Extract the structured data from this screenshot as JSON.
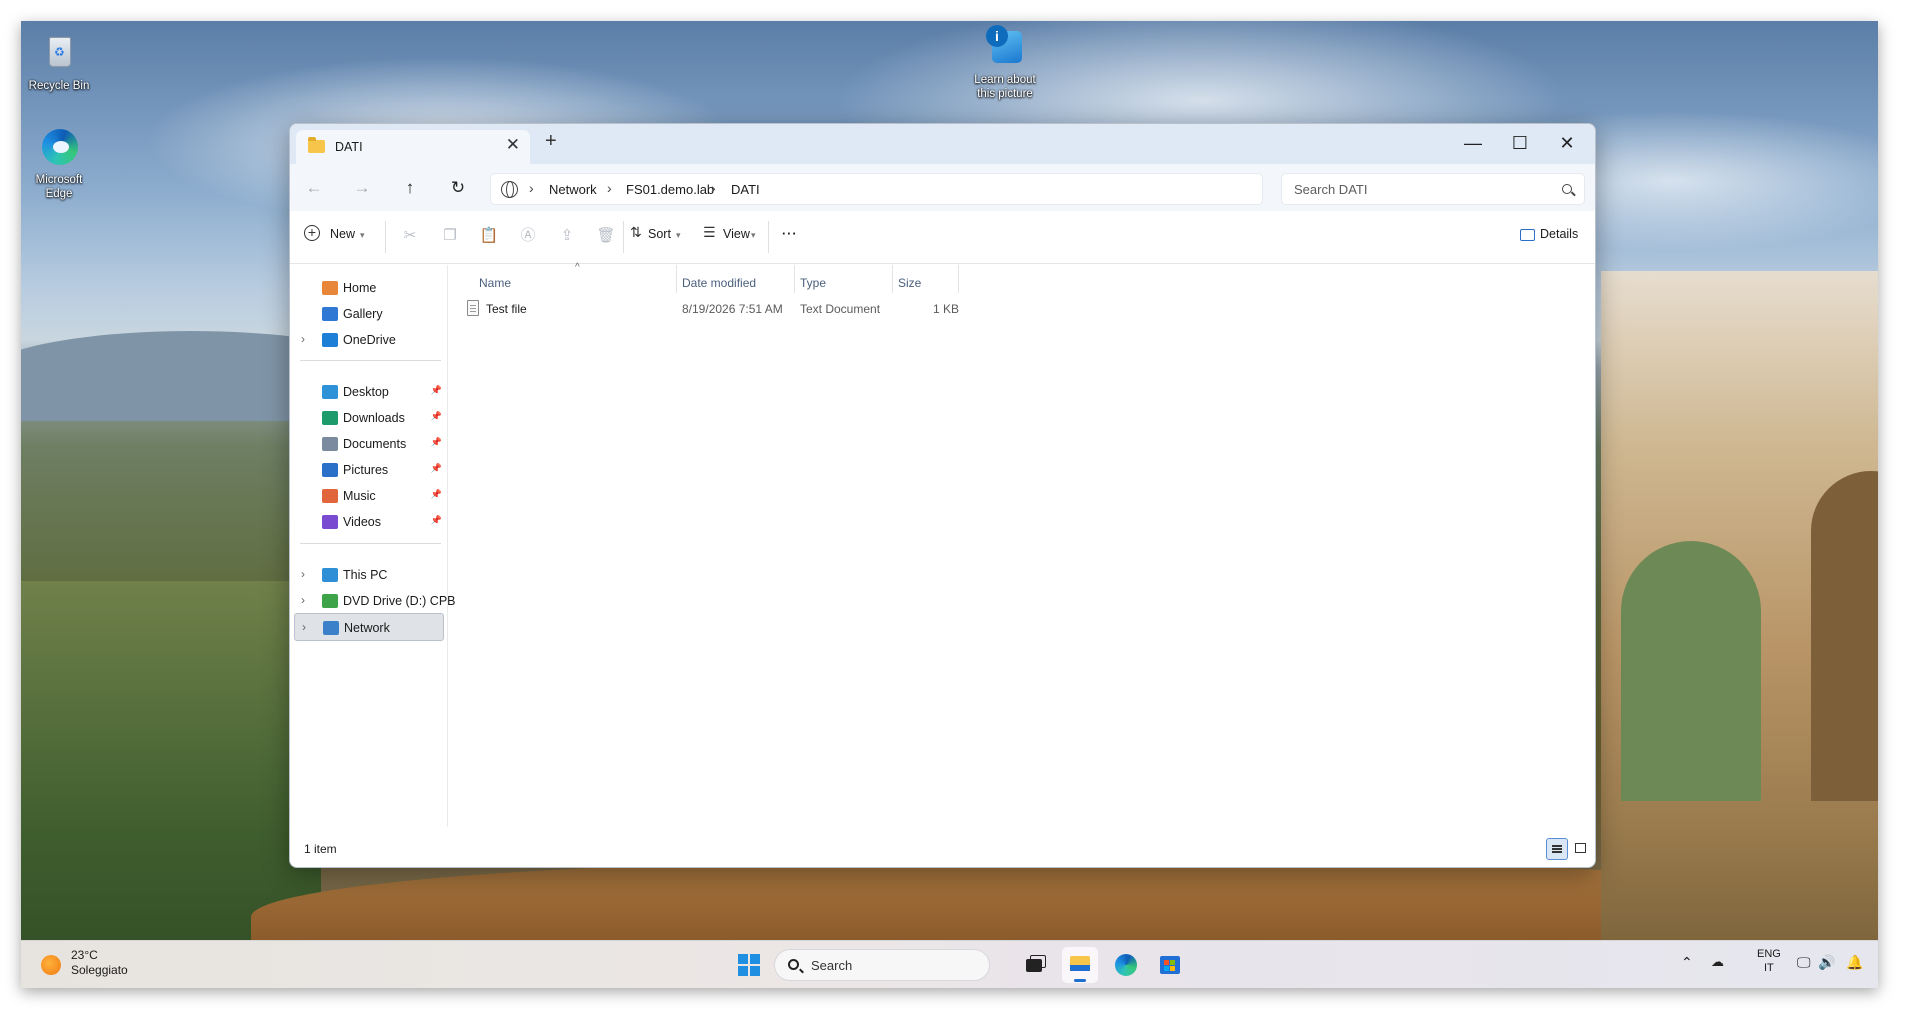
{
  "desktop": {
    "icons": [
      {
        "label": "Recycle Bin"
      },
      {
        "label": "Learn about this picture"
      },
      {
        "label": "Microsoft Edge"
      }
    ]
  },
  "window": {
    "tab_title": "DATI",
    "new_tab_symbol": "+",
    "controls": {
      "minimize": "—",
      "maximize": "☐",
      "close": "✕"
    }
  },
  "navigation": {
    "back_icon": "arrow-left-icon",
    "forward_icon": "arrow-right-icon",
    "up_icon": "arrow-up-icon",
    "refresh_icon": "refresh-icon",
    "breadcrumb": [
      "Network",
      "FS01.demo.lab",
      "DATI"
    ],
    "search_placeholder": "Search DATI"
  },
  "commandbar": {
    "new_label": "New",
    "sort_label": "Sort",
    "view_label": "View",
    "more_label": "···",
    "details_label": "Details"
  },
  "sidebar": {
    "groups": [
      [
        {
          "label": "Home",
          "icon": "home-icon",
          "color": "#e8863a"
        },
        {
          "label": "Gallery",
          "icon": "gallery-icon",
          "color": "#2f78d4"
        },
        {
          "label": "OneDrive",
          "icon": "cloud-icon",
          "color": "#1e7fd6"
        }
      ],
      [
        {
          "label": "Desktop",
          "icon": "desktop-icon",
          "color": "#2e92d8"
        },
        {
          "label": "Downloads",
          "icon": "download-icon",
          "color": "#1d9b6c"
        },
        {
          "label": "Documents",
          "icon": "document-icon",
          "color": "#7c8aa0"
        },
        {
          "label": "Pictures",
          "icon": "pictures-icon",
          "color": "#2a70c9"
        },
        {
          "label": "Music",
          "icon": "music-icon",
          "color": "#e2663b"
        },
        {
          "label": "Videos",
          "icon": "video-icon",
          "color": "#7a4bd1"
        }
      ],
      [
        {
          "label": "This PC",
          "icon": "pc-icon",
          "color": "#2f8fd6"
        },
        {
          "label": "DVD Drive (D:) CPB",
          "icon": "dvd-icon",
          "color": "#3fa34a"
        },
        {
          "label": "Network",
          "icon": "network-icon",
          "color": "#3b80c9"
        }
      ]
    ],
    "selected": "Network"
  },
  "filelist": {
    "columns": [
      "Name",
      "Date modified",
      "Type",
      "Size"
    ],
    "sort_indicator": "^",
    "rows": [
      {
        "name": "Test file",
        "date_modified": "8/19/2026 7:51 AM",
        "type": "Text Document",
        "size": "1 KB"
      }
    ]
  },
  "status": {
    "item_count": "1 item"
  },
  "taskbar": {
    "weather_temp": "23°C",
    "weather_desc": "Soleggiato",
    "search_placeholder": "Search",
    "lang_top": "ENG",
    "lang_bottom": "IT"
  }
}
